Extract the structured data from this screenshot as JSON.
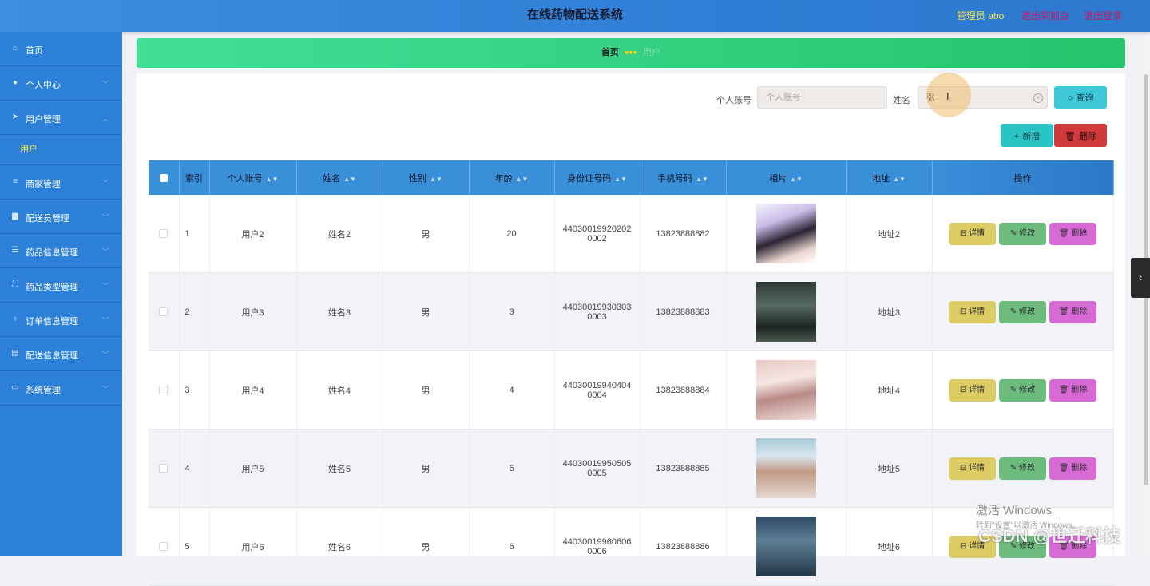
{
  "header": {
    "title": "在线药物配送系统",
    "admin": "管理员 abo",
    "back_link": "退出到前台",
    "logout_link": "退出登录"
  },
  "sidebar": {
    "items": [
      {
        "label": "首页",
        "icon": "home-icon"
      },
      {
        "label": "个人中心",
        "icon": "user-icon"
      },
      {
        "label": "用户管理",
        "icon": "send-icon"
      },
      {
        "label": "商家管理",
        "icon": "menu-icon"
      },
      {
        "label": "配送员管理",
        "icon": "monitor-icon"
      },
      {
        "label": "药品信息管理",
        "icon": "sliders-icon"
      },
      {
        "label": "药品类型管理",
        "icon": "crop-icon"
      },
      {
        "label": "订单信息管理",
        "icon": "mic-icon"
      },
      {
        "label": "配送信息管理",
        "icon": "ticket-icon"
      },
      {
        "label": "系统管理",
        "icon": "window-icon"
      }
    ],
    "sub_user": "用户"
  },
  "breadcrumb": {
    "home": "首页",
    "hearts": "♥♥♥",
    "current": "用户"
  },
  "search": {
    "account_label": "个人账号",
    "account_placeholder": "个人账号",
    "account_value": "",
    "name_label": "姓名",
    "name_value": "张",
    "query_button": "查询"
  },
  "actions": {
    "add": "新增",
    "delete": "删除"
  },
  "table": {
    "headers": [
      "索引",
      "个人账号",
      "姓名",
      "性别",
      "年龄",
      "身份证号码",
      "手机号码",
      "相片",
      "地址",
      "操作"
    ],
    "rows": [
      {
        "index": "1",
        "account": "用户2",
        "name": "姓名2",
        "gender": "男",
        "age": "20",
        "id1": "44030019920202",
        "id2": "0002",
        "phone": "13823888882",
        "address": "地址2"
      },
      {
        "index": "2",
        "account": "用户3",
        "name": "姓名3",
        "gender": "男",
        "age": "3",
        "id1": "44030019930303",
        "id2": "0003",
        "phone": "13823888883",
        "address": "地址3"
      },
      {
        "index": "3",
        "account": "用户4",
        "name": "姓名4",
        "gender": "男",
        "age": "4",
        "id1": "44030019940404",
        "id2": "0004",
        "phone": "13823888884",
        "address": "地址4"
      },
      {
        "index": "4",
        "account": "用户5",
        "name": "姓名5",
        "gender": "男",
        "age": "5",
        "id1": "44030019950505",
        "id2": "0005",
        "phone": "13823888885",
        "address": "地址5"
      },
      {
        "index": "5",
        "account": "用户6",
        "name": "姓名6",
        "gender": "男",
        "age": "6",
        "id1": "44030019960606",
        "id2": "0006",
        "phone": "13823888886",
        "address": "地址6"
      }
    ],
    "row_actions": {
      "detail": "详情",
      "edit": "修改",
      "delete": "删除"
    }
  },
  "watermark": {
    "activate": "激活 Windows",
    "activate_hint": "转到\"设置\"以激活 Windows。",
    "csdn": "CSDN @世迁科技"
  },
  "colors": {
    "header": "#2f7fd6",
    "sidebar": "#2c80d8",
    "breadcrumb": "#26c46d",
    "table_header": "#3a8fd9"
  }
}
